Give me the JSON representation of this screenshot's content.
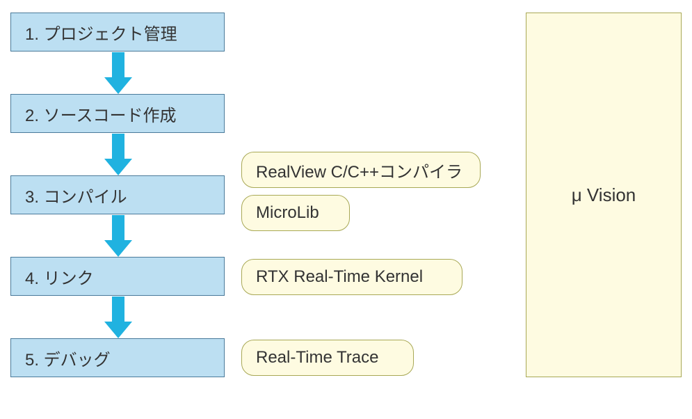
{
  "steps": [
    {
      "label": "1.  プロジェクト管理"
    },
    {
      "label": "2.  ソースコード作成"
    },
    {
      "label": "3.  コンパイル"
    },
    {
      "label": "4.  リンク"
    },
    {
      "label": "5.  デバッグ"
    }
  ],
  "components": [
    {
      "label": "RealView C/C++コンパイラ"
    },
    {
      "label": "MicroLib"
    },
    {
      "label": "RTX Real-Time Kernel"
    },
    {
      "label": "Real-Time Trace"
    }
  ],
  "ide": {
    "label": "μ Vision"
  }
}
